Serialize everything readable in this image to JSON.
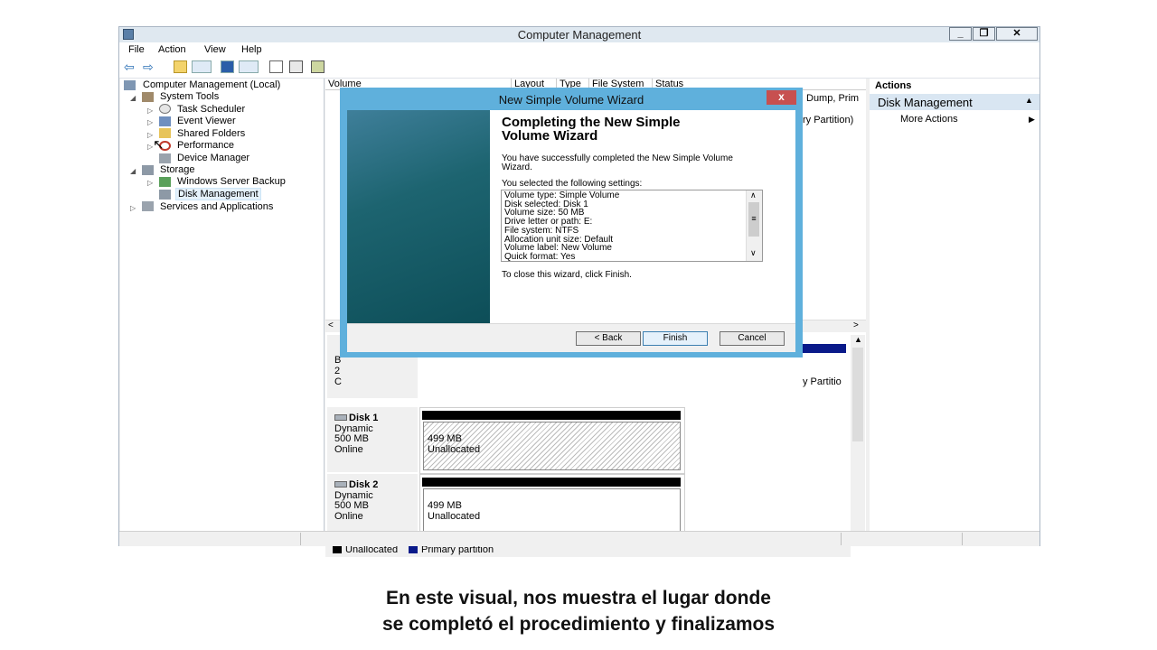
{
  "window": {
    "title": "Computer Management",
    "controls": [
      "_",
      "❐",
      "✕"
    ]
  },
  "menu": [
    "File",
    "Action",
    "View",
    "Help"
  ],
  "tree": {
    "root": "Computer Management (Local)",
    "system_tools": "System Tools",
    "task_scheduler": "Task Scheduler",
    "event_viewer": "Event Viewer",
    "shared_folders": "Shared Folders",
    "performance": "Performance",
    "device_manager": "Device Manager",
    "storage": "Storage",
    "windows_server_backup": "Windows Server Backup",
    "disk_management": "Disk Management",
    "services_apps": "Services and Applications"
  },
  "volume_headers": [
    "Volume",
    "Layout",
    "Type",
    "File System",
    "Status"
  ],
  "volume_overflow": {
    "row1": "Dump, Prim",
    "row2": "ry Partition)",
    "disk0_part": "y Partitio"
  },
  "disk0": {
    "labels": [
      "B",
      "2",
      "C"
    ]
  },
  "disks": [
    {
      "name": "Disk 1",
      "type": "Dynamic",
      "size": "500 MB",
      "status": "Online",
      "part_size": "499 MB",
      "part_state": "Unallocated"
    },
    {
      "name": "Disk 2",
      "type": "Dynamic",
      "size": "500 MB",
      "status": "Online",
      "part_size": "499 MB",
      "part_state": "Unallocated"
    }
  ],
  "legend": {
    "unallocated": "Unallocated",
    "primary": "Primary partition",
    "unallocated_color": "#000000",
    "primary_color": "#0a1a8a"
  },
  "actions": {
    "header": "Actions",
    "section": "Disk Management",
    "more": "More Actions"
  },
  "wizard": {
    "title": "New Simple Volume Wizard",
    "heading_line1": "Completing the New Simple",
    "heading_line2": "Volume Wizard",
    "success_line1": "You have successfully completed the New Simple Volume",
    "success_line2": "Wizard.",
    "selected": "You selected the following settings:",
    "settings": [
      "Volume type: Simple Volume",
      "Disk selected: Disk 1",
      "Volume size: 50 MB",
      "Drive letter or path: E:",
      "File system: NTFS",
      "Allocation unit size: Default",
      "Volume label: New Volume",
      "Quick format: Yes"
    ],
    "close_hint": "To close this wizard, click Finish.",
    "back": "< Back",
    "finish": "Finish",
    "cancel": "Cancel",
    "close_glyph": "x"
  },
  "caption": {
    "line1": "En este visual, nos muestra el lugar donde",
    "line2": "se completó el procedimiento y finalizamos"
  }
}
